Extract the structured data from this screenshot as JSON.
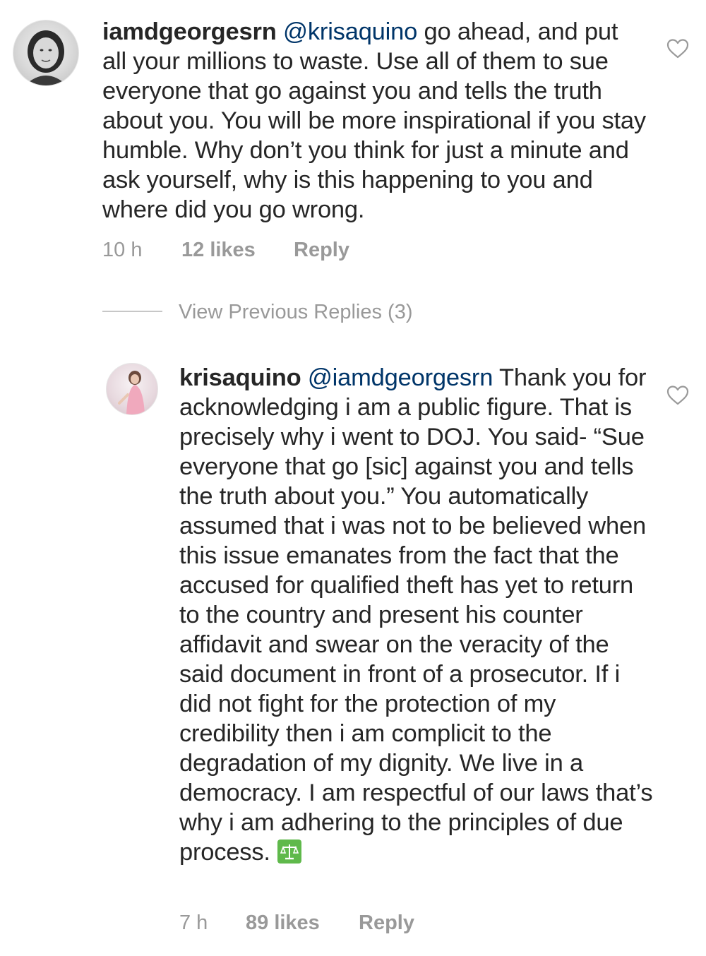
{
  "comments": [
    {
      "username": "iamdgeorgesrn",
      "mention": "@krisaquino",
      "text": "go ahead, and put all your millions to waste. Use all of them to sue everyone that go against you and tells the truth about you. You will be more inspirational if you stay humble. Why don’t you think for just a minute and ask yourself, why is this happening to you and where did you go wrong.",
      "time": "10 h",
      "likes": "12 likes",
      "reply": "Reply",
      "avatar_icon": "avatar-woman-bw",
      "like_icon": "heart-outline-icon"
    },
    {
      "username": "krisaquino",
      "mention": "@iamdgeorgesrn",
      "text": "Thank you for acknowledging i am a public figure. That is precisely why i went to DOJ. You said- “Sue everyone that go [sic] against you and tells the truth about you.” You automatically assumed that i was not to be believed when this issue emanates from the fact that the accused for qualified theft has yet to return to the country and present his counter affidavit and swear on the veracity of the said document in front of a prosecutor. If i did not fight for the protection of my credibility then i am complicit to the degradation of my dignity. We live in a democracy. I am respectful of our laws that’s why i am adhering to the principles of due process.",
      "emoji": "balance-scale-emoji",
      "time": "7 h",
      "likes": "89 likes",
      "reply": "Reply",
      "avatar_icon": "avatar-woman-pink-dress",
      "like_icon": "heart-outline-icon"
    }
  ],
  "view_previous_replies": "View Previous Replies (3)",
  "colors": {
    "text": "#262626",
    "mention": "#003569",
    "meta": "#999999",
    "emoji_bg": "#5fb94b"
  }
}
